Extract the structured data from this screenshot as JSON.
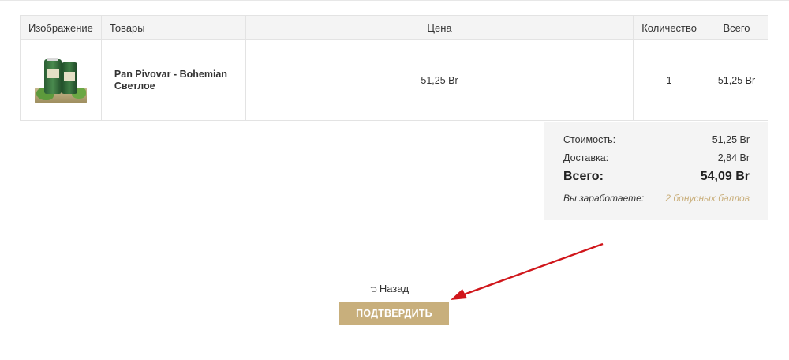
{
  "table": {
    "headers": {
      "image": "Изображение",
      "product": "Товары",
      "price": "Цена",
      "quantity": "Количество",
      "total": "Всего"
    },
    "rows": [
      {
        "name": "Pan Pivovar - Bohemian Светлое",
        "price": "51,25 Br",
        "quantity": "1",
        "total": "51,25 Br"
      }
    ]
  },
  "totals": {
    "subtotal_label": "Стоимость:",
    "subtotal_value": "51,25 Br",
    "shipping_label": "Доставка:",
    "shipping_value": "2,84 Br",
    "grand_label": "Всего:",
    "grand_value": "54,09 Br",
    "bonus_label": "Вы заработаете:",
    "bonus_value": "2 бонусных баллов"
  },
  "actions": {
    "back_label": "Назад",
    "confirm_label": "ПОДТВЕРДИТЬ"
  },
  "colors": {
    "accent": "#c8af7c",
    "annotation_arrow": "#d0161b"
  },
  "icons": {
    "back": "return-arrow-icon"
  }
}
